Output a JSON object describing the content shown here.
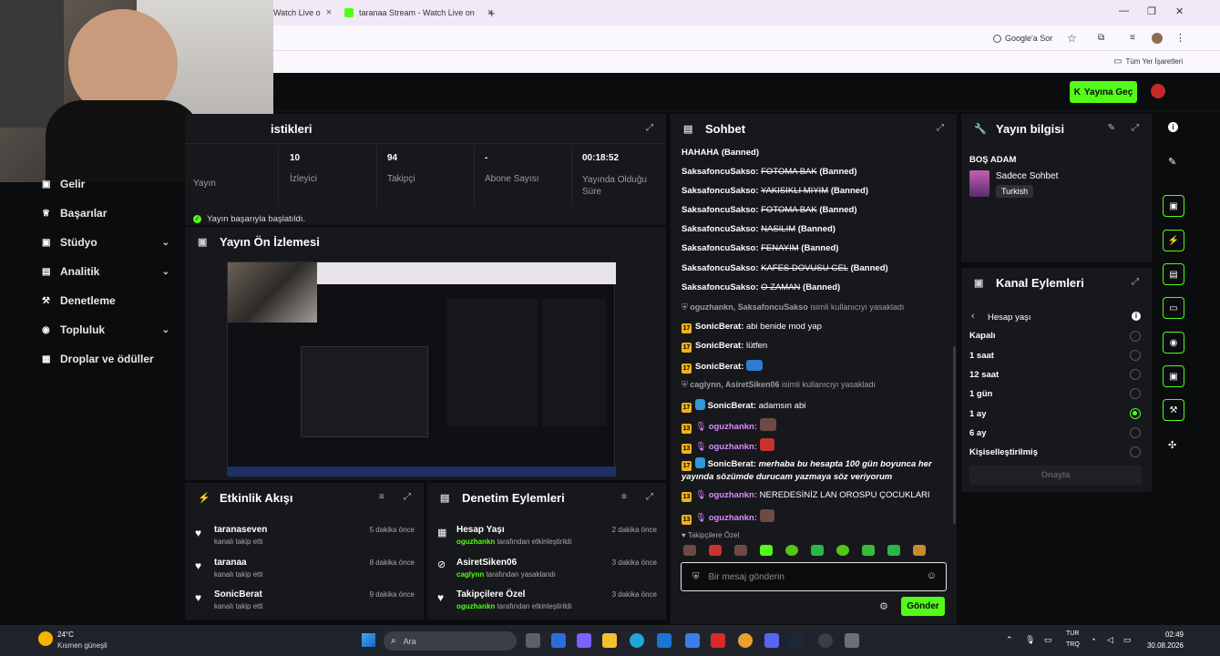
{
  "browser": {
    "tabs": [
      {
        "label": "Watch Live o"
      },
      {
        "label": "taranaa Stream - Watch Live on"
      }
    ],
    "new_tab": "+",
    "google_chip": "Google'a Sor",
    "bookmarks_label": "Tüm Yer İşaretleri"
  },
  "topbar": {
    "go_live": "Yayına Geç"
  },
  "sidebar": {
    "items": [
      {
        "label": "Gelir",
        "icon": "wallet-icon"
      },
      {
        "label": "Başarılar",
        "icon": "trophy-icon"
      },
      {
        "label": "Stüdyo",
        "icon": "studio-icon",
        "expandable": true
      },
      {
        "label": "Analitik",
        "icon": "chart-icon",
        "expandable": true
      },
      {
        "label": "Denetleme",
        "icon": "hammer-icon"
      },
      {
        "label": "Topluluk",
        "icon": "community-icon",
        "expandable": true
      },
      {
        "label": "Droplar ve ödüller",
        "icon": "gift-icon"
      }
    ]
  },
  "stats": {
    "title_fragment": "istikleri",
    "first_label": "Yayın",
    "items": [
      {
        "value": "10",
        "label": "İzleyici"
      },
      {
        "value": "94",
        "label": "Takipçi"
      },
      {
        "value": "-",
        "label": "Abone Sayısı"
      },
      {
        "value": "00:18:52",
        "label": "Yayında Olduğu Süre"
      }
    ],
    "status": "Yayın başarıyla başlatıldı."
  },
  "preview": {
    "title": "Yayın Ön İzlemesi"
  },
  "activity": {
    "title": "Etkinlik Akışı",
    "events": [
      {
        "name": "taranaseven",
        "sub": "kanalı takip etti",
        "time": "5 dakika önce"
      },
      {
        "name": "taranaa",
        "sub": "kanalı takip etti",
        "time": "8 dakika önce"
      },
      {
        "name": "SonicBerat",
        "sub": "kanalı takip etti",
        "time": "9 dakika önce"
      }
    ]
  },
  "moderation": {
    "title": "Denetim Eylemleri",
    "events": [
      {
        "name": "Hesap Yaşı",
        "actor": "oguzhankn",
        "rest": " tarafından etkinleştirildi",
        "time": "2 dakika önce"
      },
      {
        "name": "AsiretSiken06",
        "actor": "caglynn",
        "rest": " tarafından yasaklandı",
        "time": "3 dakika önce"
      },
      {
        "name": "Takipçilere Özel",
        "actor": "oguzhankn",
        "rest": " tarafından etkinleştirildi",
        "time": "3 dakika önce"
      }
    ]
  },
  "chat": {
    "title": "Sohbet",
    "lines": [
      {
        "user": "",
        "msg": "HAHAHA",
        "tag": "(Banned)"
      },
      {
        "user": "SaksafoncuSakso:",
        "msg": "FOTOMA BAK",
        "tag": "(Banned)"
      },
      {
        "user": "SaksafoncuSakso:",
        "msg": "YAKISIKLI MIYIM",
        "tag": "(Banned)"
      },
      {
        "user": "SaksafoncuSakso:",
        "msg": "FOTOMA BAK",
        "tag": "(Banned)"
      },
      {
        "user": "SaksafoncuSakso:",
        "msg": "NASILIM",
        "tag": "(Banned)"
      },
      {
        "user": "SaksafoncuSakso:",
        "msg": "FENAYIM",
        "tag": "(Banned)"
      },
      {
        "user": "SaksafoncuSakso:",
        "msg": "KAFES DOVUSU GEL",
        "tag": "(Banned)"
      },
      {
        "user": "SaksafoncuSakso:",
        "msg": "O ZAMAN",
        "tag": "(Banned)"
      }
    ],
    "sys1_users": "oguzhankn, SaksafoncuSakso",
    "sys1_text": " isimli kullanıcıyı yasakladı",
    "sonic_lines": [
      {
        "badge": "17",
        "user": "SonicBerat:",
        "msg": "abi benide mod yap"
      },
      {
        "badge": "17",
        "user": "SonicBerat:",
        "msg": "lütfen"
      },
      {
        "badge": "17",
        "user": "SonicBerat:",
        "msg": ""
      }
    ],
    "sys2_users": "caglynn, AsiretSiken06",
    "sys2_text": " isimli kullanıcıyı yasakladı",
    "later": [
      {
        "badge": "17",
        "user": "SonicBerat:",
        "msg": "adamsın abi"
      },
      {
        "badge": "13",
        "user": "oguzhankn:",
        "msg": ""
      },
      {
        "badge": "13",
        "user": "oguzhankn:",
        "msg": ""
      }
    ],
    "long_user": "SonicBerat:",
    "long_msg": "merhaba bu hesapta 100 gün boyunca her yayında sözümde durucam yazmaya söz veriyorum",
    "last": [
      {
        "badge": "13",
        "user": "oguzhankn:",
        "msg": "NEREDESİNİZ LAN OROSPU ÇOCUKLARI"
      },
      {
        "badge": "13",
        "user": "oguzhankn:",
        "msg": ""
      }
    ],
    "followers_only": "Takipçilere Özel",
    "input_placeholder": "Bir mesaj gönderin",
    "send": "Gönder"
  },
  "stream_info": {
    "title": "Yayın bilgisi",
    "stream_title": "BOŞ ADAM",
    "category": "Sadece Sohbet",
    "language": "Turkish"
  },
  "channel_actions": {
    "title": "Kanal Eylemleri",
    "sub": "Hesap yaşı",
    "options": [
      {
        "label": "Kapalı",
        "selected": false
      },
      {
        "label": "1 saat",
        "selected": false
      },
      {
        "label": "12 saat",
        "selected": false
      },
      {
        "label": "1 gün",
        "selected": false
      },
      {
        "label": "1 ay",
        "selected": true
      },
      {
        "label": "6 ay",
        "selected": false
      },
      {
        "label": "Kişiselleştirilmiş",
        "selected": false
      }
    ],
    "confirm": "Onayla"
  },
  "taskbar": {
    "weather_temp": "24°C",
    "weather_desc": "Kısmen güneşli",
    "search": "Ara",
    "lang1": "TUR",
    "lang2": "TRQ",
    "time": "02:49",
    "date": "30.08.2026"
  },
  "colors": {
    "accent": "#53fc18",
    "panel": "#17181b",
    "bg": "#0b0c0e",
    "badge": "#f2b11b",
    "mod": "#d98cff"
  }
}
